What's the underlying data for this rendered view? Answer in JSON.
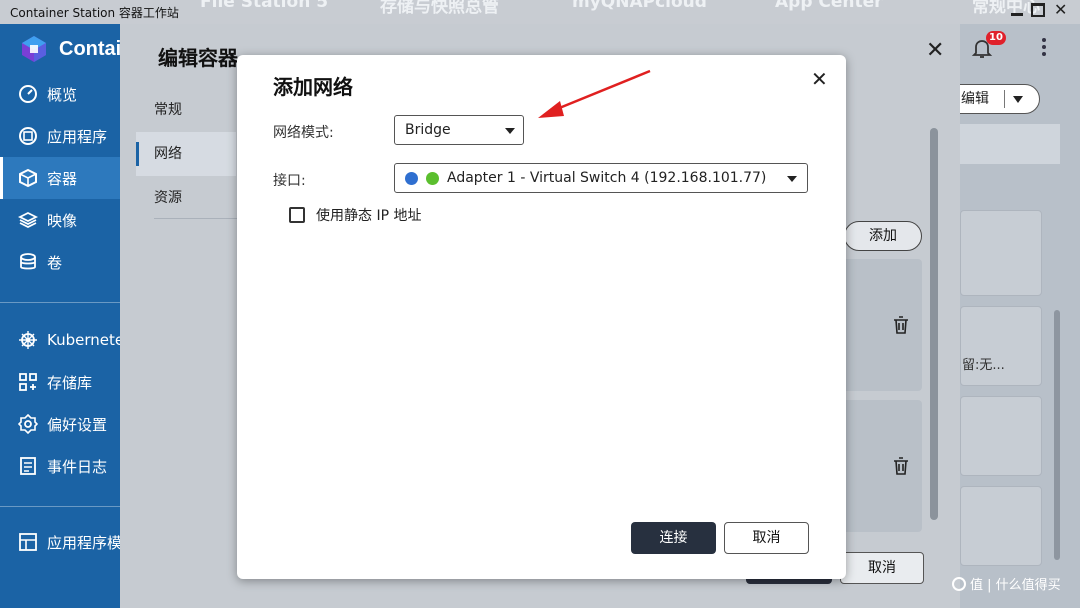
{
  "window": {
    "app_title": "Container Station 容器工作站",
    "background_tabs": [
      "File Station 5",
      "存储与快照总管",
      "myQNAPcloud",
      "App Center",
      "常规中心"
    ]
  },
  "sidebar": {
    "brand": "Contai",
    "items": [
      {
        "label": "概览",
        "icon": "dashboard-icon"
      },
      {
        "label": "应用程序",
        "icon": "apps-icon"
      },
      {
        "label": "容器",
        "icon": "container-cube-icon",
        "active": true
      },
      {
        "label": "映像",
        "icon": "layers-icon"
      },
      {
        "label": "卷",
        "icon": "database-icon"
      },
      {
        "label": "Kubernetes",
        "icon": "helm-wheel-icon"
      },
      {
        "label": "存储库",
        "icon": "grid-icon"
      },
      {
        "label": "偏好设置",
        "icon": "gear-icon"
      },
      {
        "label": "事件日志",
        "icon": "log-icon"
      },
      {
        "label": "应用程序模",
        "icon": "template-icon"
      }
    ]
  },
  "header_right": {
    "notification_count": "10",
    "edit_button": "编辑",
    "card_text": "留:无..."
  },
  "edit_dialog": {
    "title": "编辑容器",
    "nav": [
      {
        "label": "常规"
      },
      {
        "label": "网络",
        "active": true
      },
      {
        "label": "资源"
      }
    ],
    "add_label": "添加",
    "cancel_label": "取消"
  },
  "network_dialog": {
    "title": "添加网络",
    "mode_label": "网络模式:",
    "mode_value": "Bridge",
    "interface_label": "接口:",
    "interface_value": "Adapter 1 - Virtual Switch 4 (192.168.101.77)",
    "static_ip_label": "使用静态 IP 地址",
    "static_ip_checked": false,
    "connect_label": "连接",
    "cancel_label": "取消"
  },
  "watermark": "值 | 什么值得买",
  "colors": {
    "sidebar_bg": "#1b63a5",
    "primary_button": "#27303f",
    "annotation_arrow": "#e02020",
    "badge": "#e0212b"
  }
}
